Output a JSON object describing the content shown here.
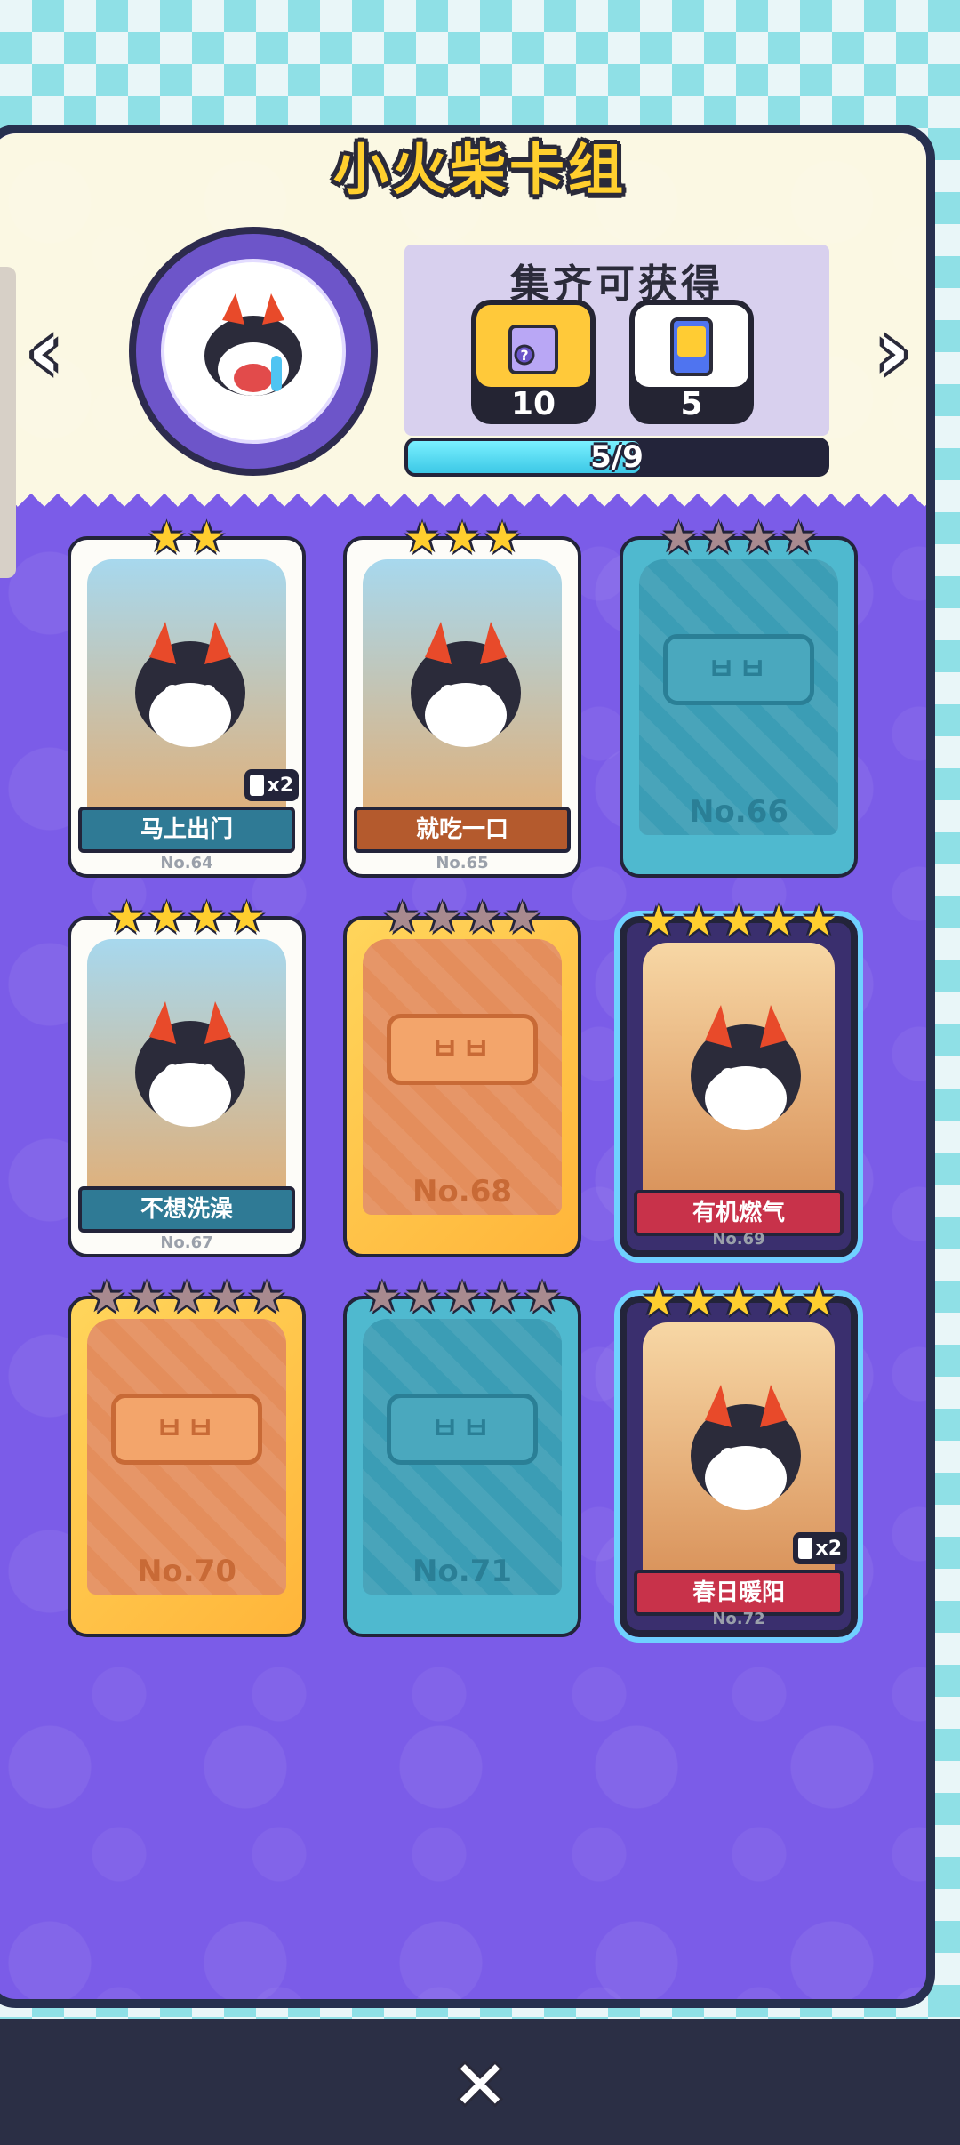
{
  "title": "小火柴卡组",
  "reward": {
    "heading": "集齐可获得",
    "items": [
      {
        "icon": "mystery-box-icon",
        "count": "10"
      },
      {
        "icon": "card-pack-icon",
        "count": "5"
      }
    ]
  },
  "progress": {
    "label": "5/9",
    "value": 0.5556
  },
  "cards": [
    {
      "name": "马上出门",
      "number": "No.64",
      "stars": 2,
      "max_stars": 2,
      "collected": true,
      "duplicate": "x2",
      "style": "white",
      "banner_color": "#2f7a95"
    },
    {
      "name": "就吃一口",
      "number": "No.65",
      "stars": 3,
      "max_stars": 3,
      "collected": true,
      "duplicate": "",
      "style": "white",
      "banner_color": "#b45a2d"
    },
    {
      "name": "",
      "number": "No.66",
      "stars": 0,
      "max_stars": 4,
      "collected": false,
      "duplicate": "",
      "style": "teal"
    },
    {
      "name": "不想洗澡",
      "number": "No.67",
      "stars": 4,
      "max_stars": 4,
      "collected": true,
      "duplicate": "",
      "style": "white",
      "banner_color": "#2f7a95"
    },
    {
      "name": "",
      "number": "No.68",
      "stars": 0,
      "max_stars": 4,
      "collected": false,
      "duplicate": "",
      "style": "gold"
    },
    {
      "name": "有机燃气",
      "number": "No.69",
      "stars": 5,
      "max_stars": 5,
      "collected": true,
      "duplicate": "",
      "style": "holo",
      "banner_color": "#c8324a"
    },
    {
      "name": "",
      "number": "No.70",
      "stars": 0,
      "max_stars": 5,
      "collected": false,
      "duplicate": "",
      "style": "gold"
    },
    {
      "name": "",
      "number": "No.71",
      "stars": 0,
      "max_stars": 5,
      "collected": false,
      "duplicate": "",
      "style": "teal"
    },
    {
      "name": "春日暖阳",
      "number": "No.72",
      "stars": 5,
      "max_stars": 5,
      "collected": true,
      "duplicate": "x2",
      "style": "holo",
      "banner_color": "#c8324a"
    }
  ],
  "locked_logo": "ㅂㅂ",
  "icons": {
    "prev": "chevron-left-icon",
    "next": "chevron-right-icon",
    "close": "close-icon"
  }
}
